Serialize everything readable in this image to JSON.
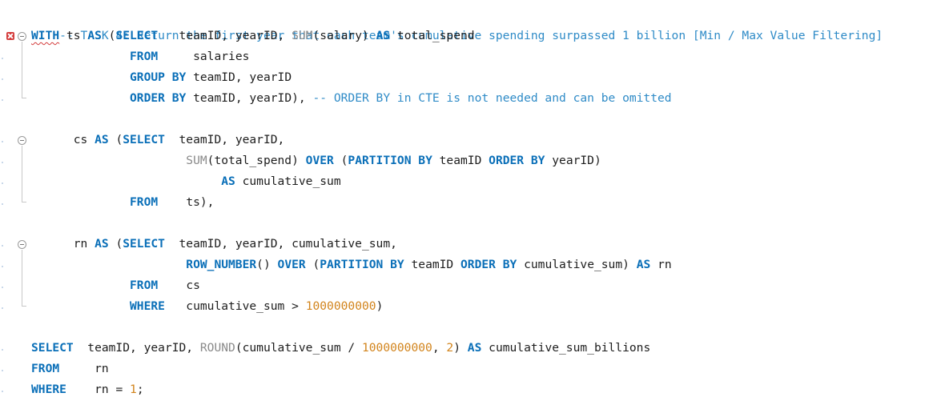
{
  "editor": {
    "comment_task": "-- TASK 4: Return the first year that each team's cumulative spending surpassed 1 billion [Min / Max Value Filtering]",
    "lines": {
      "l2": {
        "kw1": "WITH",
        "sp1": " ts ",
        "kw2": "AS",
        "sp2": " (",
        "kw3": "SELECT",
        "sp3": "   teamID, yearID, ",
        "fn": "SUM",
        "sp4": "(salary) ",
        "kw4": "AS",
        "sp5": " total_spend"
      },
      "l3": {
        "indent": "              ",
        "kw1": "FROM",
        "sp1": "     salaries"
      },
      "l4": {
        "indent": "              ",
        "kw1": "GROUP",
        "sp0": " ",
        "kw2": "BY",
        "sp1": " teamID, yearID"
      },
      "l5": {
        "indent": "              ",
        "kw1": "ORDER",
        "sp0": " ",
        "kw2": "BY",
        "sp1": " teamID, yearID), ",
        "cm": "-- ORDER BY in CTE is not needed and can be omitted"
      },
      "l7": {
        "indent": "      ",
        "id1": "cs ",
        "kw1": "AS",
        "sp1": " (",
        "kw2": "SELECT",
        "sp2": "  teamID, yearID,"
      },
      "l8": {
        "indent": "                      ",
        "fn": "SUM",
        "sp1": "(total_spend) ",
        "kw1": "OVER",
        "sp2": " (",
        "kw2": "PARTITION",
        "sp3": " ",
        "kw3": "BY",
        "sp4": " teamID ",
        "kw4": "ORDER",
        "sp5": " ",
        "kw5": "BY",
        "sp6": " yearID)"
      },
      "l9": {
        "indent": "                           ",
        "kw1": "AS",
        "sp1": " cumulative_sum"
      },
      "l10": {
        "indent": "              ",
        "kw1": "FROM",
        "sp1": "    ts),"
      },
      "l12": {
        "indent": "      ",
        "id1": "rn ",
        "kw1": "AS",
        "sp1": " (",
        "kw2": "SELECT",
        "sp2": "  teamID, yearID, cumulative_sum,"
      },
      "l13": {
        "indent": "                      ",
        "fn": "ROW_NUMBER",
        "sp1": "() ",
        "kw1": "OVER",
        "sp2": " (",
        "kw2": "PARTITION",
        "sp3": " ",
        "kw3": "BY",
        "sp4": " teamID ",
        "kw4": "ORDER",
        "sp5": " ",
        "kw5": "BY",
        "sp6": " cumulative_sum) ",
        "kw6": "AS",
        "sp7": " rn"
      },
      "l14": {
        "indent": "              ",
        "kw1": "FROM",
        "sp1": "    cs"
      },
      "l15": {
        "indent": "              ",
        "kw1": "WHERE",
        "sp1": "   cumulative_sum > ",
        "num": "1000000000",
        "sp2": ")"
      },
      "l17": {
        "kw1": "SELECT",
        "sp1": "  teamID, yearID, ",
        "fn": "ROUND",
        "sp2": "(cumulative_sum / ",
        "num1": "1000000000",
        "sp3": ", ",
        "num2": "2",
        "sp4": ") ",
        "kw2": "AS",
        "sp5": " cumulative_sum_billions"
      },
      "l18": {
        "kw1": "FROM",
        "sp1": "     rn"
      },
      "l19": {
        "kw1": "WHERE",
        "sp1": "    rn = ",
        "num": "1",
        "sp2": ";"
      }
    }
  },
  "colors": {
    "keyword": "#0a6fb8",
    "function": "#8a8a8a",
    "number": "#d2841c",
    "comment": "#2f8bc7",
    "error": "#d33a3a"
  },
  "icons": {
    "error_marker": "error-x-icon",
    "fold_markers": "fold-collapse-icon"
  }
}
